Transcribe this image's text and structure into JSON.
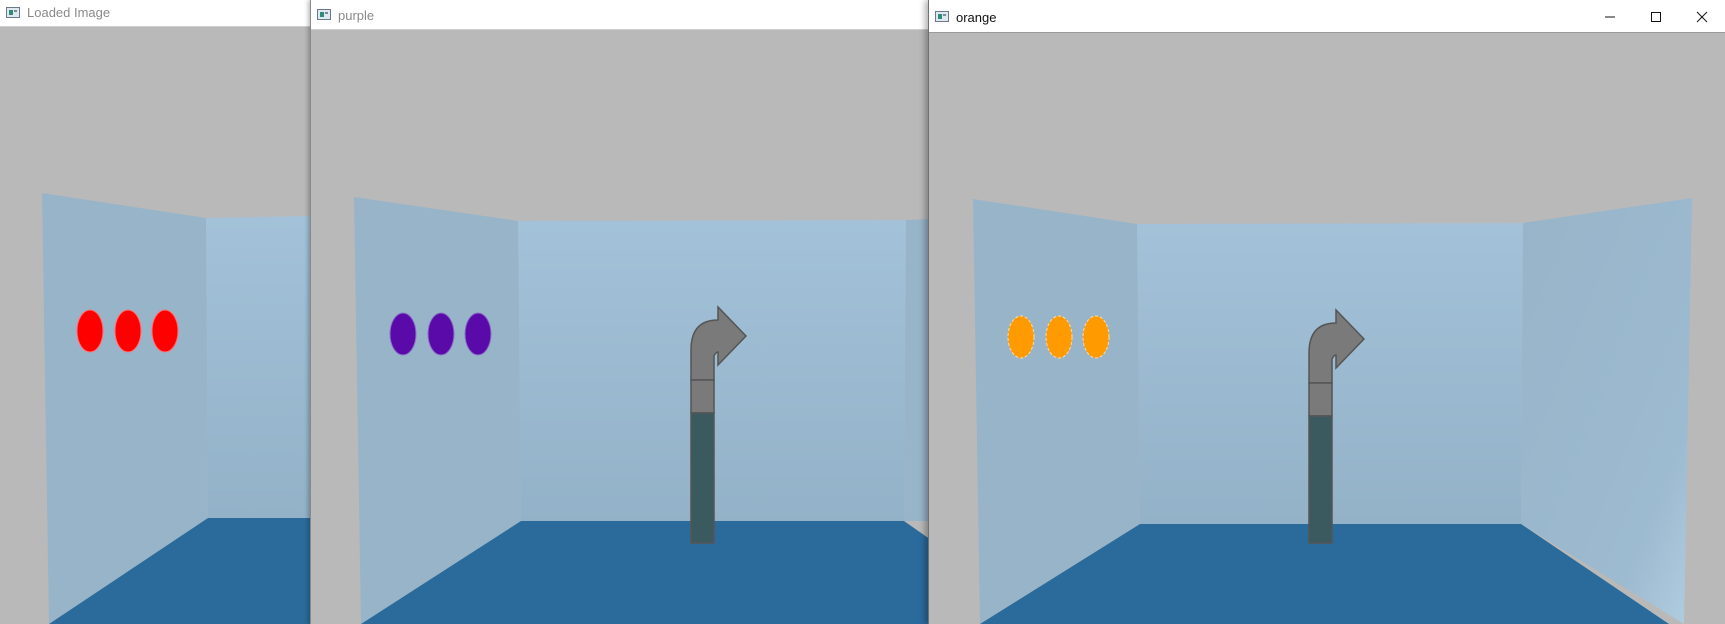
{
  "windows": [
    {
      "title": "Loaded Image",
      "icon": "opencv-window-icon",
      "ellipse_color": "#ff0000",
      "active": false
    },
    {
      "title": "purple",
      "icon": "opencv-window-icon",
      "ellipse_color": "#5a0aa8",
      "active": false
    },
    {
      "title": "orange",
      "icon": "opencv-window-icon",
      "ellipse_color": "#ff9a00",
      "active": true
    }
  ],
  "controls": {
    "minimize": "minimize-icon",
    "maximize": "maximize-icon",
    "close": "close-icon"
  },
  "colors": {
    "background": "#b9b9b9",
    "wall_left": "#98b4c9",
    "wall_back": "#9cbbd3",
    "floor": "#2a6b9c",
    "arrow_gray": "#7a7a7a",
    "arrow_dark": "#3a5a60"
  }
}
